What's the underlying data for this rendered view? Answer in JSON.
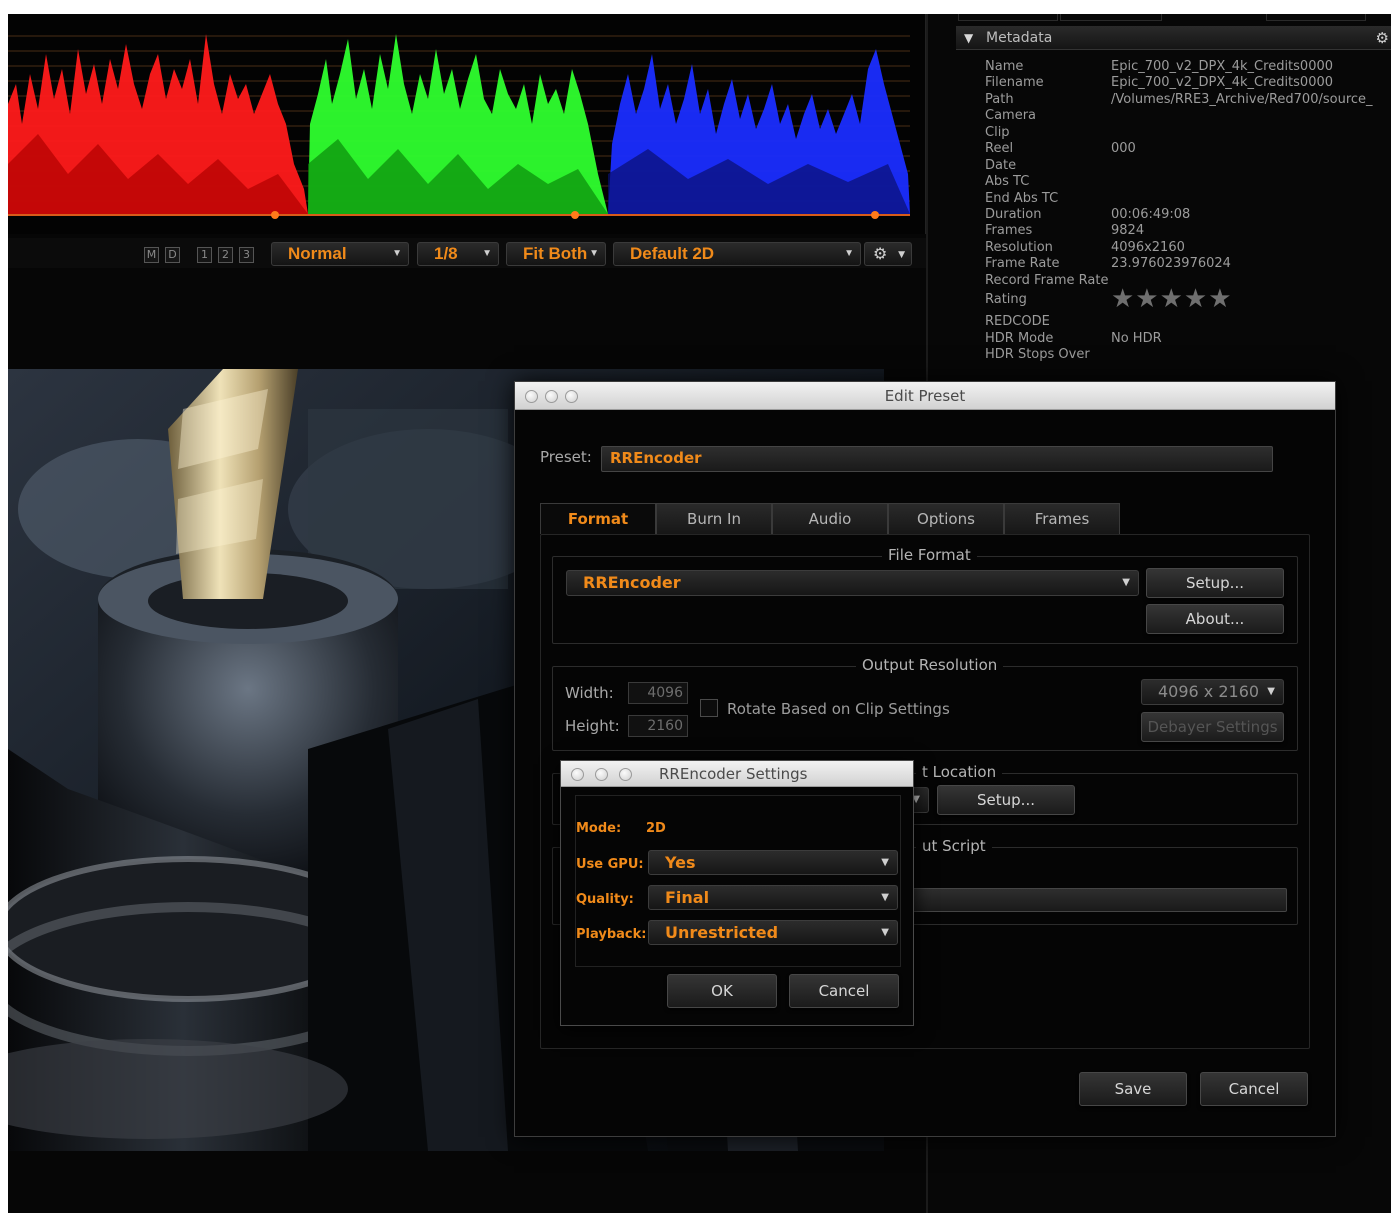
{
  "viewer_toolbar": {
    "mini_buttons": [
      "M",
      "D",
      "1",
      "2",
      "3"
    ],
    "mode": "Normal",
    "scale": "1/8",
    "fit": "Fit Both",
    "view": "Default 2D"
  },
  "metadata": {
    "header": "Metadata",
    "rows": [
      {
        "key": "Name",
        "value": "Epic_700_v2_DPX_4k_Credits0000"
      },
      {
        "key": "Filename",
        "value": "Epic_700_v2_DPX_4k_Credits0000"
      },
      {
        "key": "Path",
        "value": "/Volumes/RRE3_Archive/Red700/source_"
      },
      {
        "key": "Camera",
        "value": ""
      },
      {
        "key": "Clip",
        "value": ""
      },
      {
        "key": "Reel",
        "value": "000"
      },
      {
        "key": "Date",
        "value": ""
      },
      {
        "key": "Abs TC",
        "value": ""
      },
      {
        "key": "End Abs TC",
        "value": ""
      },
      {
        "key": "Duration",
        "value": "00:06:49:08"
      },
      {
        "key": "Frames",
        "value": "9824"
      },
      {
        "key": "Resolution",
        "value": "4096x2160"
      },
      {
        "key": "Frame Rate",
        "value": "23.976023976024"
      },
      {
        "key": "Record Frame Rate",
        "value": ""
      }
    ],
    "rating_label": "Rating",
    "rating_stars": "★★★★★",
    "rows2": [
      {
        "key": "REDCODE",
        "value": ""
      },
      {
        "key": "HDR Mode",
        "value": "No HDR"
      },
      {
        "key": "HDR Stops Over",
        "value": ""
      }
    ]
  },
  "edit_preset": {
    "title": "Edit Preset",
    "preset_label": "Preset:",
    "preset_value": "RREncoder",
    "tabs": [
      "Format",
      "Burn In",
      "Audio",
      "Options",
      "Frames"
    ],
    "file_format": {
      "legend": "File Format",
      "value": "RREncoder",
      "setup": "Setup...",
      "about": "About..."
    },
    "output_resolution": {
      "legend": "Output Resolution",
      "width_label": "Width:",
      "width": "4096",
      "height_label": "Height:",
      "height": "2160",
      "rotate_label": "Rotate Based on Clip Settings",
      "preset": "4096 x 2160",
      "debayer": "Debayer Settings"
    },
    "location": {
      "legend": "t Location",
      "setup": "Setup..."
    },
    "script": {
      "legend": "ut Script"
    },
    "save": "Save",
    "cancel": "Cancel"
  },
  "rr_settings": {
    "title": "RREncoder Settings",
    "mode_label": "Mode:",
    "mode_value": "2D",
    "gpu_label": "Use GPU:",
    "gpu_value": "Yes",
    "quality_label": "Quality:",
    "quality_value": "Final",
    "playback_label": "Playback:",
    "playback_value": "Unrestricted",
    "ok": "OK",
    "cancel": "Cancel"
  },
  "colors": {
    "accent": "#f08a1a",
    "scope_red": "#ff1a1a",
    "scope_green": "#2eff2e",
    "scope_blue": "#1a2dff"
  }
}
